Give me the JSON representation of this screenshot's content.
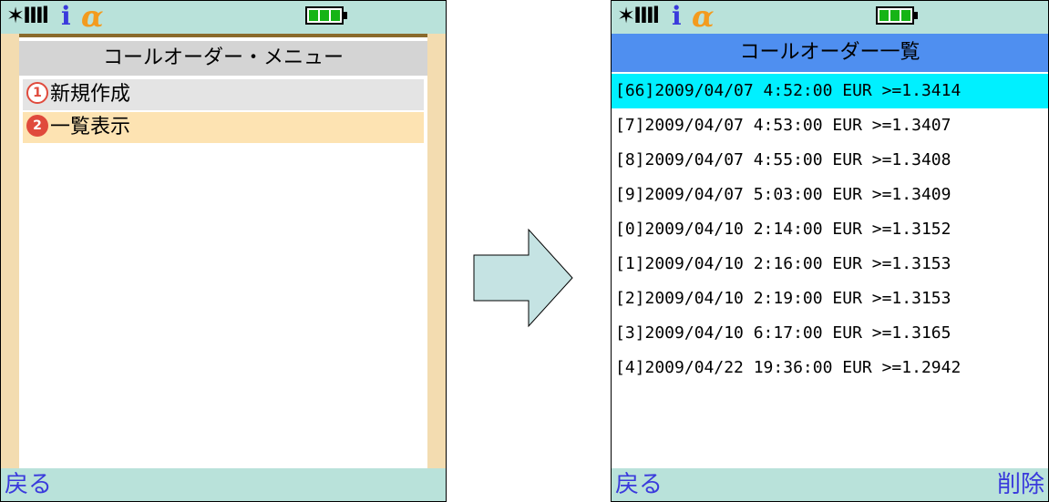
{
  "left_screen": {
    "title": "コールオーダー・メニュー",
    "menu_items": [
      {
        "number": "1",
        "label": "新規作成"
      },
      {
        "number": "2",
        "label": "一覧表示"
      }
    ],
    "softkey_left": "戻る"
  },
  "right_screen": {
    "title": "コールオーダー一覧",
    "orders": [
      "[66]2009/04/07 4:52:00 EUR >=1.3414",
      "[7]2009/04/07 4:53:00 EUR >=1.3407",
      "[8]2009/04/07 4:55:00 EUR >=1.3408",
      "[9]2009/04/07 5:03:00 EUR >=1.3409",
      "[0]2009/04/10 2:14:00 EUR >=1.3152",
      "[1]2009/04/10 2:16:00 EUR >=1.3153",
      "[2]2009/04/10 2:19:00 EUR >=1.3153",
      "[3]2009/04/10 6:17:00 EUR >=1.3165",
      "[4]2009/04/22 19:36:00 EUR >=1.2942"
    ],
    "selected_index": 0,
    "softkey_left": "戻る",
    "softkey_right": "削除"
  },
  "status_icons": {
    "signal": "signal-bars-icon",
    "i_mode": "i-mode-icon",
    "alpha": "alpha-icon",
    "battery": "battery-full-icon"
  },
  "colors": {
    "statusbar": "#b9e2da",
    "list_header": "#4f8ff0",
    "selected_row": "#00f0ff",
    "menu_highlight": "#fde3b2",
    "arrow_fill": "#c5e3e3"
  }
}
